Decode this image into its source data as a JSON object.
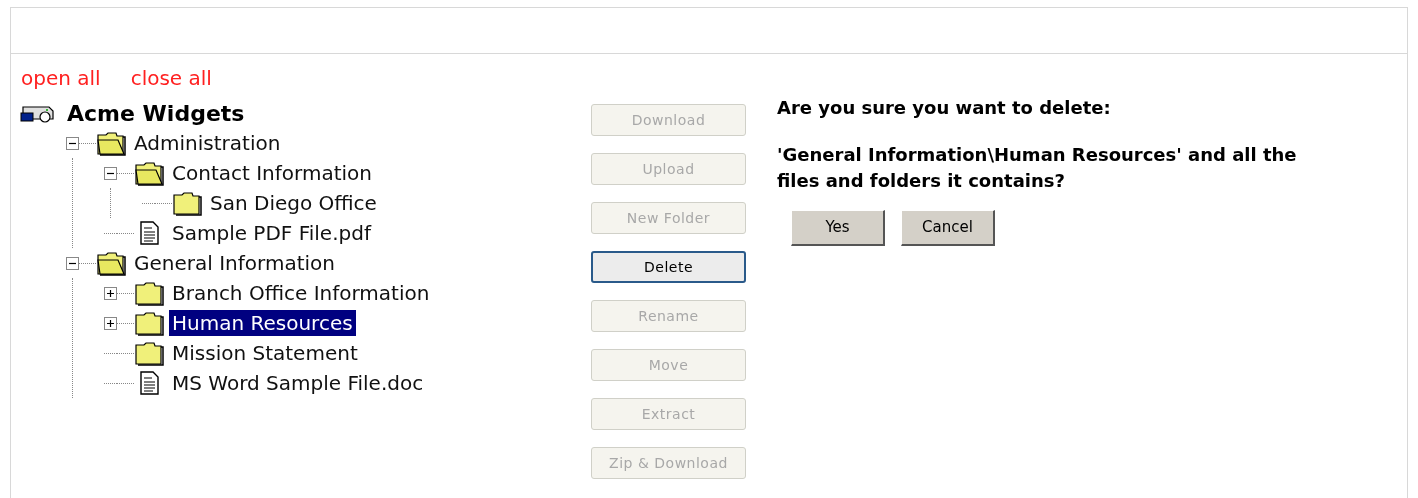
{
  "links": [
    "open all",
    "close all"
  ],
  "tree": {
    "label": "Acme Widgets",
    "selected": false,
    "children": [
      {
        "label": "Administration",
        "kind": "folder",
        "expanded": true,
        "selected": false,
        "children": [
          {
            "label": "Contact Information",
            "kind": "folder",
            "expanded": true,
            "selected": false,
            "children": [
              {
                "label": "San Diego Office",
                "kind": "folder",
                "selected": false
              }
            ]
          },
          {
            "label": "Sample PDF File.pdf",
            "kind": "file",
            "selected": false
          }
        ]
      },
      {
        "label": "General Information",
        "kind": "folder",
        "expanded": true,
        "selected": false,
        "children": [
          {
            "label": "Branch Office Information",
            "kind": "folder",
            "expanded": false,
            "selected": false
          },
          {
            "label": "Human Resources",
            "kind": "folder",
            "expanded": false,
            "selected": true
          },
          {
            "label": "Mission Statement",
            "kind": "folder",
            "selected": false
          },
          {
            "label": "MS Word Sample File.doc",
            "kind": "file",
            "selected": false
          }
        ]
      }
    ]
  },
  "actions": [
    {
      "label": "Download",
      "disabled": true,
      "focused": false
    },
    {
      "label": "Upload",
      "disabled": true,
      "focused": false
    },
    {
      "label": "New Folder",
      "disabled": true,
      "focused": false
    },
    {
      "label": "Delete",
      "disabled": false,
      "focused": true
    },
    {
      "label": "Rename",
      "disabled": true,
      "focused": false
    },
    {
      "label": "Move",
      "disabled": true,
      "focused": false
    },
    {
      "label": "Extract",
      "disabled": true,
      "focused": false
    },
    {
      "label": "Zip & Download",
      "disabled": true,
      "focused": false
    }
  ],
  "dialog": {
    "question": "Are you sure you want to delete:",
    "detail": "'General Information\\Human Resources' and all the files and folders it contains?",
    "buttons": [
      "Yes",
      "Cancel"
    ]
  }
}
